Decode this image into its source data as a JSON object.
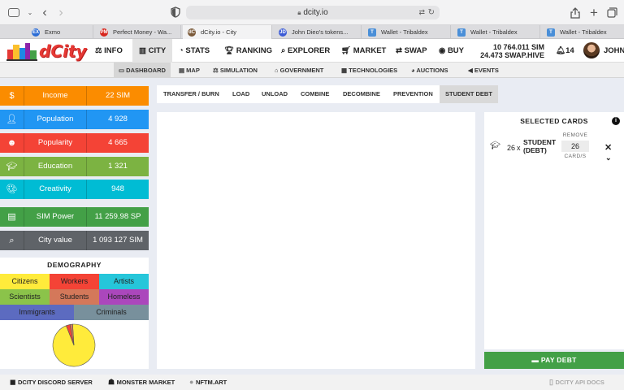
{
  "browser": {
    "url": "dcity.io",
    "tabs": [
      {
        "label": "Exmo",
        "fav": "EX",
        "color": "#2b6cd6"
      },
      {
        "label": "Perfect Money - Wa...",
        "fav": "PM",
        "color": "#d7261d"
      },
      {
        "label": "dCity.io - City",
        "fav": "dC",
        "color": "#7b5a3a"
      },
      {
        "label": "John Dieo's tokens...",
        "fav": "JD",
        "color": "#3b5bd6"
      },
      {
        "label": "Wallet - Tribaldex",
        "fav": "T",
        "color": "#4a8fd8"
      },
      {
        "label": "Wallet - Tribaldex",
        "fav": "T",
        "color": "#4a8fd8"
      },
      {
        "label": "Wallet - Tribaldex",
        "fav": "T",
        "color": "#4a8fd8"
      }
    ]
  },
  "nav": {
    "logo": "dCity",
    "items": [
      "INFO",
      "CITY",
      "STATS",
      "RANKING",
      "EXPLORER",
      "MARKET",
      "SWAP",
      "BUY"
    ],
    "balance_sim": "10 764.011 SIM",
    "balance_swap": "24.473 SWAP.HIVE",
    "notifications": "14",
    "user": "JOHN"
  },
  "subnav": [
    "DASHBOARD",
    "MAP",
    "SIMULATION",
    "GOVERNMENT",
    "TECHNOLOGIES",
    "AUCTIONS",
    "EVENTS"
  ],
  "stats": [
    {
      "label": "Income",
      "value": "22 SIM",
      "color": "#fb8c00",
      "icon": "dollar-icon"
    },
    {
      "label": "Population",
      "value": "4 928",
      "color": "#2196f3",
      "icon": "person-icon"
    },
    {
      "label": "Popularity",
      "value": "4 665",
      "color": "#f44336",
      "icon": "smile-icon"
    },
    {
      "label": "Education",
      "value": "1 321",
      "color": "#7cb342",
      "icon": "graduation-icon"
    },
    {
      "label": "Creativity",
      "value": "948",
      "color": "#00bcd4",
      "icon": "palette-icon"
    },
    {
      "label": "SIM Power",
      "value": "11 259.98 SP",
      "color": "#43a047",
      "icon": "money-icon"
    },
    {
      "label": "City value",
      "value": "1 093 127 SIM",
      "color": "#5f6368",
      "icon": "search-icon"
    }
  ],
  "demography": {
    "title": "DEMOGRAPHY",
    "rows": [
      [
        {
          "label": "Citizens",
          "color": "#ffeb3b"
        },
        {
          "label": "Workers",
          "color": "#f44336"
        },
        {
          "label": "Artists",
          "color": "#26c6da"
        }
      ],
      [
        {
          "label": "Scientists",
          "color": "#8bc34a"
        },
        {
          "label": "Students",
          "color": "#d4785a"
        },
        {
          "label": "Homeless",
          "color": "#ab47bc"
        }
      ],
      [
        {
          "label": "Immigrants",
          "color": "#5c6bc0"
        },
        {
          "label": "Criminals",
          "color": "#78909c"
        }
      ]
    ],
    "pie": [
      {
        "label": "Citizens",
        "value": 95,
        "color": "#ffeb3b"
      },
      {
        "label": "Workers",
        "value": 3,
        "color": "#f44336"
      },
      {
        "label": "Students",
        "value": 2,
        "color": "#d4785a"
      }
    ]
  },
  "actions": [
    "TRANSFER / BURN",
    "LOAD",
    "UNLOAD",
    "COMBINE",
    "DECOMBINE",
    "PREVENTION",
    "STUDENT DEBT"
  ],
  "selected": {
    "title": "SELECTED CARDS",
    "card_qty": "26",
    "card_x": "x",
    "card_name_1": "STUDENT",
    "card_name_2": "(DEBT)",
    "remove_label": "REMOVE",
    "remove_value": "26",
    "unit_label": "CARD/S",
    "pay_label": "PAY DEBT"
  },
  "footer": {
    "discord": "DCITY DISCORD SERVER",
    "monster": "MONSTER MARKET",
    "nftm": "NFTM.ART",
    "api": "DCITY API DOCS"
  }
}
